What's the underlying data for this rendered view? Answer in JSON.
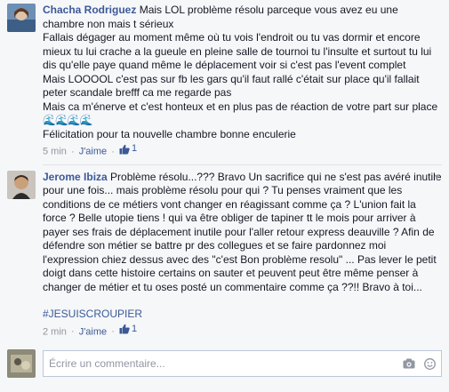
{
  "comments": [
    {
      "author": "Chacha Rodriguez",
      "text_first": " Mais LOL problème résolu parceque vous avez eu une chambre non mais t sérieux\nFallais dégager au moment même où tu vois l'endroit ou tu vas dormir et encore mieux tu lui crache a la gueule en pleine salle de tournoi tu l'insulte et surtout tu lui dis qu'elle paye quand même le déplacement voir si c'est pas l'event complet\nMais LOOOOL c'est pas sur fb les gars qu'il faut rallé c'était sur place qu'il fallait peter scandale brefff ca me regarde pas\nMais ca m'énerve et c'est honteux et en plus pas de réaction de votre part sur place ",
      "waves": "🌊🌊🌊🌊",
      "text_last": "\nFélicitation pour ta nouvelle chambre bonne enculerie",
      "time": "5 min",
      "like_label": "J'aime",
      "like_count": "1"
    },
    {
      "author": "Jerome Ibiza",
      "text": " Problème résolu...??? Bravo Un sacrifice qui ne s'est pas avéré inutile pour une fois... mais problème résolu pour qui ? Tu penses vraiment que les conditions de ce métiers vont changer en réagissant comme ça ? L'union fait la force ? Belle utopie tiens ! qui va être obliger de tapiner tt le mois pour arriver à payer ses frais de déplacement inutile pour l'aller retour express deauville ? Afin de défendre son métier se battre pr des collegues et se faire pardonnez moi l'expression chiez dessus avec des \"c'est Bon problème resolu\" ... Pas lever le petit doigt dans cette histoire certains on sauter et peuvent peut être même penser à changer de métier et tu oses posté un commentaire comme ça ??!! Bravo à toi...",
      "hashtag": "#JESUISCROUPIER",
      "time": "2 min",
      "like_label": "J'aime",
      "like_count": "1"
    }
  ],
  "composer": {
    "placeholder": "Écrire un commentaire..."
  },
  "colors": {
    "link": "#3b5998",
    "meta": "#90949c",
    "background": "#f6f7f9"
  }
}
